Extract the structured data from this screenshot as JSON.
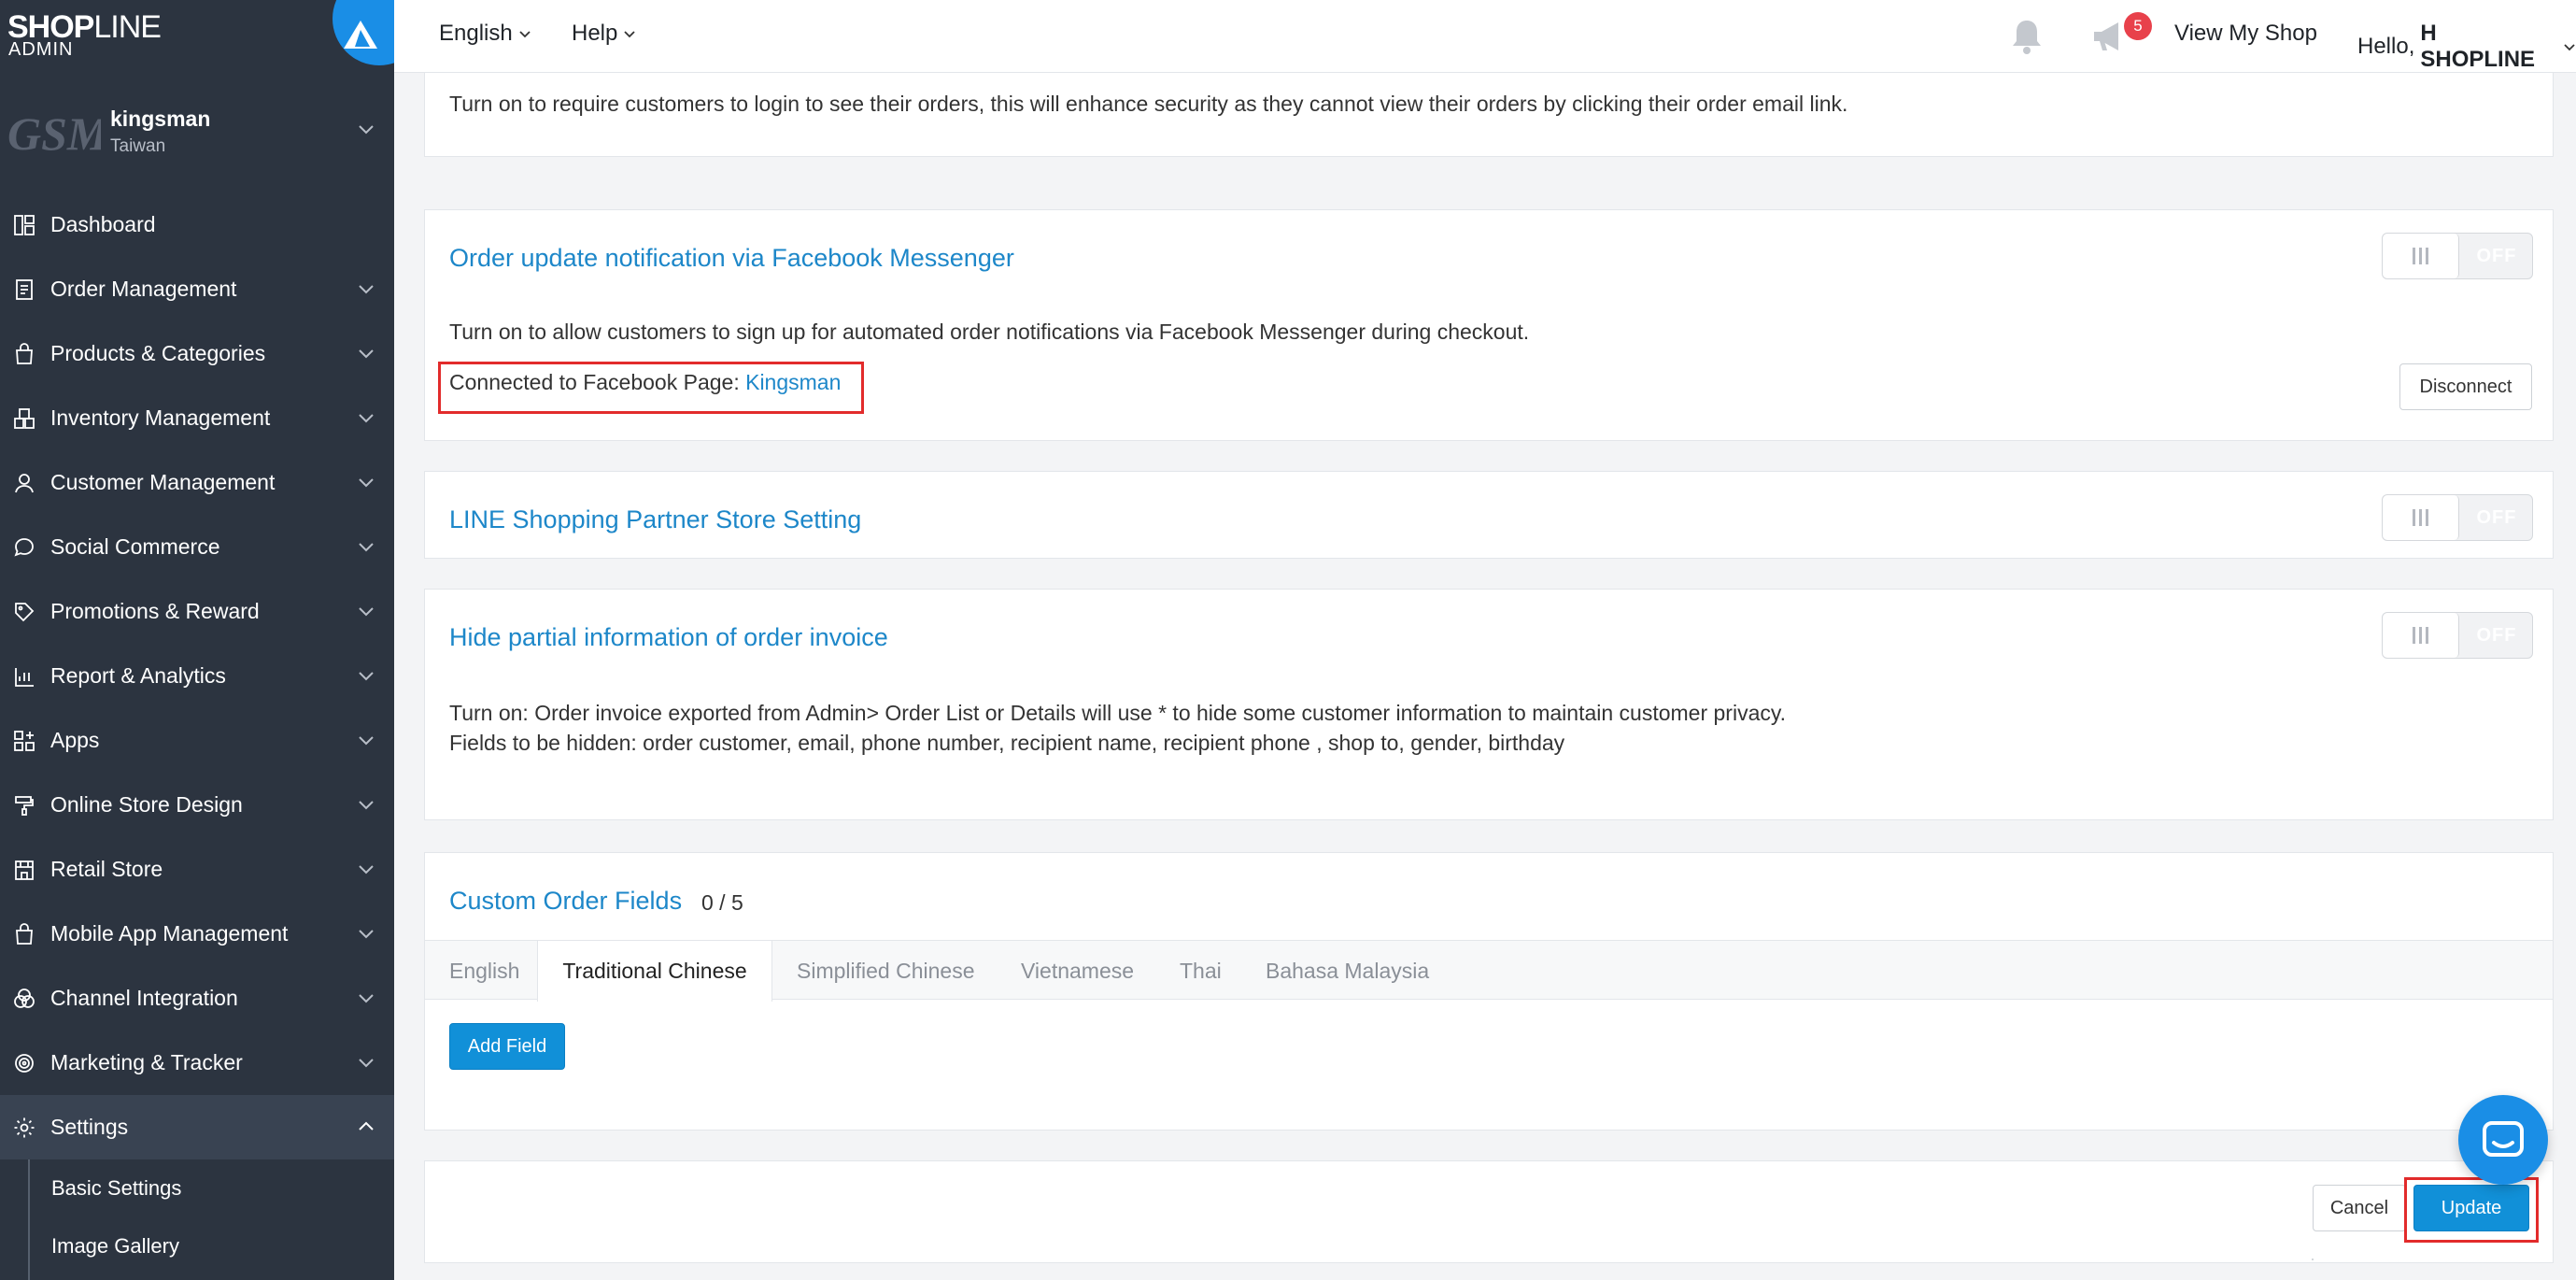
{
  "brand": {
    "logo_main": "SHOP",
    "logo_line": "LINE",
    "logo_sub": "ADMIN"
  },
  "store": {
    "logo_text": "GSM",
    "name": "kingsman",
    "region": "Taiwan"
  },
  "sidebar": {
    "items": [
      {
        "label": "Dashboard",
        "icon": "dashboard-icon",
        "has_chevron": false
      },
      {
        "label": "Order Management",
        "icon": "order-icon",
        "has_chevron": true
      },
      {
        "label": "Products & Categories",
        "icon": "bag-icon",
        "has_chevron": true
      },
      {
        "label": "Inventory Management",
        "icon": "inventory-icon",
        "has_chevron": true
      },
      {
        "label": "Customer Management",
        "icon": "user-icon",
        "has_chevron": true
      },
      {
        "label": "Social Commerce",
        "icon": "chat-icon",
        "has_chevron": true
      },
      {
        "label": "Promotions & Reward",
        "icon": "tag-icon",
        "has_chevron": true
      },
      {
        "label": "Report & Analytics",
        "icon": "chart-icon",
        "has_chevron": true
      },
      {
        "label": "Apps",
        "icon": "apps-icon",
        "has_chevron": true
      },
      {
        "label": "Online Store Design",
        "icon": "paint-roller-icon",
        "has_chevron": true
      },
      {
        "label": "Retail Store",
        "icon": "store-icon",
        "has_chevron": true
      },
      {
        "label": "Mobile App Management",
        "icon": "mobile-bag-icon",
        "has_chevron": true
      },
      {
        "label": "Channel Integration",
        "icon": "channel-icon",
        "has_chevron": true
      },
      {
        "label": "Marketing & Tracker",
        "icon": "target-icon",
        "has_chevron": true
      },
      {
        "label": "Settings",
        "icon": "gear-icon",
        "has_chevron": true,
        "active": true
      }
    ],
    "settings_sub": [
      "Basic Settings",
      "Image Gallery"
    ]
  },
  "topbar": {
    "language": "English",
    "help": "Help",
    "notification_count": "5",
    "view_shop": "View My Shop",
    "hello_prefix": "Hello,",
    "user_name": "H SHOPLINE"
  },
  "sections": {
    "login_orders": {
      "description": "Turn on to require customers to login to see their orders, this will enhance security as they cannot view their orders by clicking their order email link."
    },
    "fb_messenger": {
      "title": "Order update notification via Facebook Messenger",
      "toggle": "OFF",
      "description": "Turn on to allow customers to sign up for automated order notifications via Facebook Messenger during checkout.",
      "connected_label": "Connected to Facebook Page:",
      "connected_page": "Kingsman",
      "disconnect": "Disconnect"
    },
    "line_shopping": {
      "title": "LINE Shopping Partner Store Setting",
      "toggle": "OFF"
    },
    "hide_invoice": {
      "title": "Hide partial information of order invoice",
      "toggle": "OFF",
      "line1": "Turn on: Order invoice exported from Admin> Order List or Details will use * to hide some customer information to maintain customer privacy.",
      "line2": "Fields to be hidden: order customer, email, phone number, recipient name, recipient phone , shop to, gender, birthday"
    },
    "custom_fields": {
      "title": "Custom Order Fields",
      "count": "0 / 5",
      "tabs": [
        "English",
        "Traditional Chinese",
        "Simplified Chinese",
        "Vietnamese",
        "Thai",
        "Bahasa Malaysia"
      ],
      "active_tab": "Traditional Chinese",
      "add_field": "Add Field"
    }
  },
  "footer": {
    "cancel": "Cancel",
    "update": "Update"
  },
  "colors": {
    "sidebar": "#2c3440",
    "accent": "#1190d8",
    "title": "#1d87c9",
    "highlight": "#e22b2b"
  }
}
